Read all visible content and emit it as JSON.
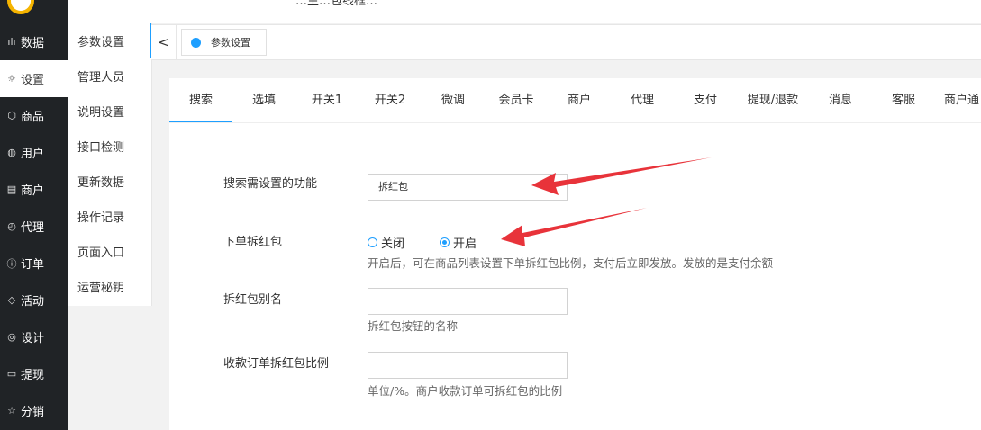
{
  "sidebar": {
    "items": [
      {
        "label": "数据",
        "icon": "bar-chart-icon",
        "glyph": "ılı"
      },
      {
        "label": "设置",
        "icon": "gear-icon",
        "glyph": "☼"
      },
      {
        "label": "商品",
        "icon": "cube-icon",
        "glyph": "⬡"
      },
      {
        "label": "用户",
        "icon": "user-icon",
        "glyph": "◍"
      },
      {
        "label": "商户",
        "icon": "shop-icon",
        "glyph": "▤"
      },
      {
        "label": "代理",
        "icon": "clock-icon",
        "glyph": "◴"
      },
      {
        "label": "订单",
        "icon": "order-icon",
        "glyph": "ⓘ"
      },
      {
        "label": "活动",
        "icon": "tag-icon",
        "glyph": "◇"
      },
      {
        "label": "设计",
        "icon": "design-icon",
        "glyph": "◎"
      },
      {
        "label": "提现",
        "icon": "card-icon",
        "glyph": "▭"
      },
      {
        "label": "分销",
        "icon": "star-icon",
        "glyph": "☆"
      }
    ]
  },
  "submenu": {
    "items": [
      "参数设置",
      "管理人员",
      "说明设置",
      "接口检测",
      "更新数据",
      "操作记录",
      "页面入口",
      "运营秘钥"
    ]
  },
  "top": {
    "partial_title": "…主…包线框…"
  },
  "tabbar": {
    "prev_glyph": "<",
    "page_tab": "参数设置"
  },
  "nav": {
    "tabs": [
      "搜索",
      "选填",
      "开关1",
      "开关2",
      "微调",
      "会员卡",
      "商户",
      "代理",
      "支付",
      "提现/退款",
      "消息",
      "客服",
      "商户通"
    ]
  },
  "form": {
    "search_label": "搜索需设置的功能",
    "search_value": "拆红包",
    "hongbao_label": "下单拆红包",
    "radio_off": "关闭",
    "radio_on": "开启",
    "hongbao_help": "开启后，可在商品列表设置下单拆红包比例，支付后立即发放。发放的是支付余额",
    "alias_label": "拆红包别名",
    "alias_value": "",
    "alias_help": "拆红包按钮的名称",
    "ratio_label": "收款订单拆红包比例",
    "ratio_value": "",
    "ratio_help": "单位/%。商户收款订单可拆红包的比例"
  },
  "colors": {
    "accent": "#1e9fff",
    "sidebar_bg": "#202326",
    "arrow": "#e8333a"
  }
}
